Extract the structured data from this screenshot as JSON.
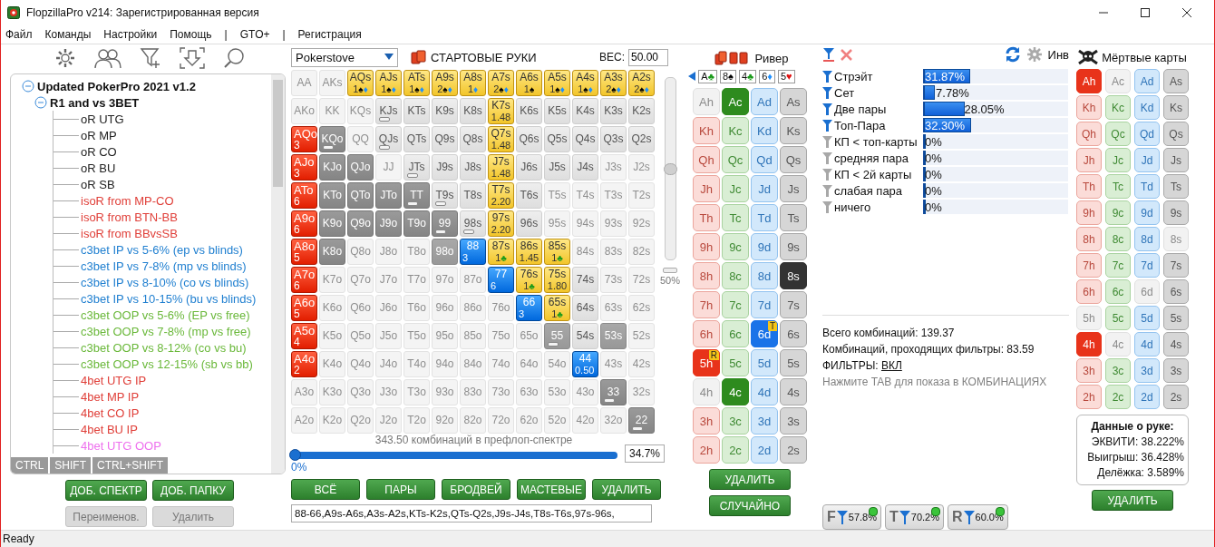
{
  "window": {
    "title": "FlopzillaPro v214: Зарегистрированная версия"
  },
  "menu": [
    "Файл",
    "Команды",
    "Настройки",
    "Помощь",
    "|",
    "GTO+",
    "|",
    "Регистрация"
  ],
  "tree": {
    "items": [
      {
        "label": "Updated PokerPro 2021 v1.2",
        "expanded": true,
        "children": [
          {
            "label": "R1 and vs 3BET",
            "expanded": true,
            "children": [
              {
                "label": "oR UTG",
                "color": "#222222"
              },
              {
                "label": "oR MP",
                "color": "#222222"
              },
              {
                "label": "oR CO",
                "color": "#222222"
              },
              {
                "label": "oR BU",
                "color": "#222222"
              },
              {
                "label": "oR SB",
                "color": "#222222"
              },
              {
                "label": "isoR from MP-CO",
                "color": "#e0403a"
              },
              {
                "label": "isoR from BTN-BB",
                "color": "#e0403a"
              },
              {
                "label": "isoR from BBvsSB",
                "color": "#e0403a"
              },
              {
                "label": "c3bet IP vs 5-6% (ep vs blinds)",
                "color": "#1f7fd0"
              },
              {
                "label": "c3bet IP vs 7-8% (mp vs blinds)",
                "color": "#1f7fd0"
              },
              {
                "label": "c3bet IP vs 8-10% (co vs blinds)",
                "color": "#1f7fd0"
              },
              {
                "label": "c3bet IP vs 10-15% (bu vs blinds)",
                "color": "#1f7fd0"
              },
              {
                "label": "c3bet OOP vs 5-6% (EP vs free)",
                "color": "#6ab83a"
              },
              {
                "label": "c3bet OOP vs 7-8% (mp vs free)",
                "color": "#6ab83a"
              },
              {
                "label": "c3bet OOP vs 8-12% (co vs bu)",
                "color": "#6ab83a"
              },
              {
                "label": "c3bet OOP vs 12-15% (sb vs bb)",
                "color": "#6ab83a"
              },
              {
                "label": "4bet UTG IP",
                "color": "#e0403a"
              },
              {
                "label": "4bet MP IP",
                "color": "#e0403a"
              },
              {
                "label": "4bet CO IP",
                "color": "#e0403a"
              },
              {
                "label": "4bet BU IP",
                "color": "#e0403a"
              },
              {
                "label": "4bet UTG OOP",
                "color": "#ee70ee"
              }
            ]
          }
        ]
      }
    ]
  },
  "modifier_tabs": [
    "CTRL",
    "SHIFT",
    "CTRL+SHIFT"
  ],
  "tree_buttons": [
    {
      "label": "ДОБ. СПЕКТР",
      "disabled": false
    },
    {
      "label": "ДОБ. ПАПКУ",
      "disabled": false
    },
    {
      "label": "Переименов.",
      "disabled": true
    },
    {
      "label": "Удалить",
      "disabled": true
    }
  ],
  "range": {
    "source": "Pokerstove",
    "title": "СТАРТОВЫЕ РУКИ",
    "weight_label": "ВЕС:",
    "weight": "50.00",
    "rows": [
      [
        {
          "label": "AA",
          "kind": "empty",
          "bar": false
        },
        {
          "label": "AKs",
          "kind": "empty",
          "bar": false
        },
        {
          "label": "AQs",
          "kind": "yellow",
          "bar": false,
          "sub": "1",
          "suits": [
            {
              "symbol": "♠",
              "color": "#000000"
            },
            {
              "symbol": "♦",
              "color": "#1e90ff"
            }
          ]
        },
        {
          "label": "AJs",
          "kind": "yellow",
          "bar": false,
          "sub": "1",
          "suits": [
            {
              "symbol": "♠",
              "color": "#000000"
            },
            {
              "symbol": "♦",
              "color": "#1e90ff"
            }
          ]
        },
        {
          "label": "ATs",
          "kind": "yellow",
          "bar": false,
          "sub": "1",
          "suits": [
            {
              "symbol": "♠",
              "color": "#000000"
            },
            {
              "symbol": "♦",
              "color": "#1e90ff"
            }
          ]
        },
        {
          "label": "A9s",
          "kind": "yellow",
          "bar": false,
          "sub": "2",
          "suits": [
            {
              "symbol": "♠",
              "color": "#000000"
            },
            {
              "symbol": "♦",
              "color": "#1e90ff"
            }
          ]
        },
        {
          "label": "A8s",
          "kind": "yellow",
          "bar": false,
          "sub": "1",
          "suits": [
            {
              "symbol": "♦",
              "color": "#1e90ff"
            }
          ]
        },
        {
          "label": "A7s",
          "kind": "yellow",
          "bar": false,
          "sub": "2",
          "suits": [
            {
              "symbol": "♠",
              "color": "#000000"
            },
            {
              "symbol": "♦",
              "color": "#1e90ff"
            }
          ]
        },
        {
          "label": "A6s",
          "kind": "yellow",
          "bar": false,
          "sub": "1",
          "suits": [
            {
              "symbol": "♠",
              "color": "#000000"
            }
          ]
        },
        {
          "label": "A5s",
          "kind": "yellow",
          "bar": false,
          "sub": "1",
          "suits": [
            {
              "symbol": "♠",
              "color": "#000000"
            },
            {
              "symbol": "♦",
              "color": "#1e90ff"
            }
          ]
        },
        {
          "label": "A4s",
          "kind": "yellow",
          "bar": false,
          "sub": "1",
          "suits": [
            {
              "symbol": "♠",
              "color": "#000000"
            },
            {
              "symbol": "♦",
              "color": "#1e90ff"
            }
          ]
        },
        {
          "label": "A3s",
          "kind": "yellow",
          "bar": false,
          "sub": "2",
          "suits": [
            {
              "symbol": "♠",
              "color": "#000000"
            },
            {
              "symbol": "♦",
              "color": "#1e90ff"
            }
          ]
        },
        {
          "label": "A2s",
          "kind": "yellow",
          "bar": false,
          "sub": "2",
          "suits": [
            {
              "symbol": "♠",
              "color": "#000000"
            },
            {
              "symbol": "♦",
              "color": "#1e90ff"
            }
          ]
        }
      ],
      [
        {
          "label": "AKo",
          "kind": "empty",
          "bar": false
        },
        {
          "label": "KK",
          "kind": "empty",
          "bar": false
        },
        {
          "label": "KQs",
          "kind": "empty",
          "bar": false
        },
        {
          "label": "KJs",
          "kind": "plain",
          "bar": true
        },
        {
          "label": "KTs",
          "kind": "plain",
          "bar": false
        },
        {
          "label": "K9s",
          "kind": "plain",
          "bar": false
        },
        {
          "label": "K8s",
          "kind": "plain",
          "bar": false
        },
        {
          "label": "K7s",
          "kind": "yellow",
          "bar": false,
          "sub": "1.48"
        },
        {
          "label": "K6s",
          "kind": "plain",
          "bar": false
        },
        {
          "label": "K5s",
          "kind": "plain",
          "bar": false
        },
        {
          "label": "K4s",
          "kind": "plain",
          "bar": false
        },
        {
          "label": "K3s",
          "kind": "plain",
          "bar": false
        },
        {
          "label": "K2s",
          "kind": "plain",
          "bar": false
        }
      ],
      [
        {
          "label": "AQo",
          "kind": "red",
          "bar": false,
          "sub": "3"
        },
        {
          "label": "KQo",
          "kind": "gray",
          "bar": true
        },
        {
          "label": "QQ",
          "kind": "empty",
          "bar": false
        },
        {
          "label": "QJs",
          "kind": "plain",
          "bar": true
        },
        {
          "label": "QTs",
          "kind": "plain",
          "bar": false
        },
        {
          "label": "Q9s",
          "kind": "plain",
          "bar": false
        },
        {
          "label": "Q8s",
          "kind": "plain",
          "bar": false
        },
        {
          "label": "Q7s",
          "kind": "yellow",
          "bar": false,
          "sub": "1.48"
        },
        {
          "label": "Q6s",
          "kind": "plain",
          "bar": false
        },
        {
          "label": "Q5s",
          "kind": "plain",
          "bar": false
        },
        {
          "label": "Q4s",
          "kind": "plain",
          "bar": false
        },
        {
          "label": "Q3s",
          "kind": "plain",
          "bar": false
        },
        {
          "label": "Q2s",
          "kind": "plain",
          "bar": false
        }
      ],
      [
        {
          "label": "AJo",
          "kind": "red",
          "bar": false,
          "sub": "3"
        },
        {
          "label": "KJo",
          "kind": "gray",
          "bar": false
        },
        {
          "label": "QJo",
          "kind": "gray",
          "bar": false
        },
        {
          "label": "JJ",
          "kind": "empty",
          "bar": false
        },
        {
          "label": "JTs",
          "kind": "plain",
          "bar": true
        },
        {
          "label": "J9s",
          "kind": "plain",
          "bar": false
        },
        {
          "label": "J8s",
          "kind": "plain",
          "bar": false
        },
        {
          "label": "J7s",
          "kind": "yellow",
          "bar": false,
          "sub": "1.48"
        },
        {
          "label": "J6s",
          "kind": "plain",
          "bar": false
        },
        {
          "label": "J5s",
          "kind": "plain",
          "bar": false
        },
        {
          "label": "J4s",
          "kind": "plain",
          "bar": false
        },
        {
          "label": "J3s",
          "kind": "empty",
          "bar": false
        },
        {
          "label": "J2s",
          "kind": "empty",
          "bar": false
        }
      ],
      [
        {
          "label": "ATo",
          "kind": "red",
          "bar": false,
          "sub": "6"
        },
        {
          "label": "KTo",
          "kind": "gray",
          "bar": false
        },
        {
          "label": "QTo",
          "kind": "gray",
          "bar": false
        },
        {
          "label": "JTo",
          "kind": "gray",
          "bar": false
        },
        {
          "label": "TT",
          "kind": "gray",
          "bar": true
        },
        {
          "label": "T9s",
          "kind": "plain",
          "bar": true
        },
        {
          "label": "T8s",
          "kind": "plain",
          "bar": false
        },
        {
          "label": "T7s",
          "kind": "yellow",
          "bar": false,
          "sub": "2.20"
        },
        {
          "label": "T6s",
          "kind": "plain",
          "bar": false
        },
        {
          "label": "T5s",
          "kind": "empty",
          "bar": false
        },
        {
          "label": "T4s",
          "kind": "empty",
          "bar": false
        },
        {
          "label": "T3s",
          "kind": "empty",
          "bar": false
        },
        {
          "label": "T2s",
          "kind": "empty",
          "bar": false
        }
      ],
      [
        {
          "label": "A9o",
          "kind": "red",
          "bar": false,
          "sub": "6"
        },
        {
          "label": "K9o",
          "kind": "gray",
          "bar": false
        },
        {
          "label": "Q9o",
          "kind": "gray",
          "bar": false
        },
        {
          "label": "J9o",
          "kind": "gray",
          "bar": false
        },
        {
          "label": "T9o",
          "kind": "gray",
          "bar": false
        },
        {
          "label": "99",
          "kind": "gray",
          "bar": true
        },
        {
          "label": "98s",
          "kind": "plain",
          "bar": true
        },
        {
          "label": "97s",
          "kind": "yellow",
          "bar": false,
          "sub": "2.20"
        },
        {
          "label": "96s",
          "kind": "plain",
          "bar": false
        },
        {
          "label": "95s",
          "kind": "empty",
          "bar": false
        },
        {
          "label": "94s",
          "kind": "empty",
          "bar": false
        },
        {
          "label": "93s",
          "kind": "empty",
          "bar": false
        },
        {
          "label": "92s",
          "kind": "empty",
          "bar": false
        }
      ],
      [
        {
          "label": "A8o",
          "kind": "red",
          "bar": false,
          "sub": "5"
        },
        {
          "label": "K8o",
          "kind": "gray",
          "bar": false
        },
        {
          "label": "Q8o",
          "kind": "empty",
          "bar": false
        },
        {
          "label": "J8o",
          "kind": "empty",
          "bar": false
        },
        {
          "label": "T8o",
          "kind": "empty",
          "bar": false
        },
        {
          "label": "98o",
          "kind": "mid",
          "bar": false
        },
        {
          "label": "88",
          "kind": "blue",
          "bar": false,
          "sub": "3"
        },
        {
          "label": "87s",
          "kind": "yellow",
          "bar": false,
          "sub": "1",
          "suits": [
            {
              "symbol": "♣",
              "color": "#1a9a1a"
            }
          ]
        },
        {
          "label": "86s",
          "kind": "yellow",
          "bar": false,
          "sub": "1.45"
        },
        {
          "label": "85s",
          "kind": "yellow",
          "bar": false,
          "sub": "1",
          "suits": [
            {
              "symbol": "♣",
              "color": "#1a9a1a"
            }
          ]
        },
        {
          "label": "84s",
          "kind": "empty",
          "bar": false
        },
        {
          "label": "83s",
          "kind": "empty",
          "bar": false
        },
        {
          "label": "82s",
          "kind": "empty",
          "bar": false
        }
      ],
      [
        {
          "label": "A7o",
          "kind": "red",
          "bar": false,
          "sub": "6"
        },
        {
          "label": "K7o",
          "kind": "empty",
          "bar": false
        },
        {
          "label": "Q7o",
          "kind": "empty",
          "bar": false
        },
        {
          "label": "J7o",
          "kind": "empty",
          "bar": false
        },
        {
          "label": "T7o",
          "kind": "empty",
          "bar": false
        },
        {
          "label": "97o",
          "kind": "empty",
          "bar": false
        },
        {
          "label": "87o",
          "kind": "empty",
          "bar": false
        },
        {
          "label": "77",
          "kind": "blue",
          "bar": false,
          "sub": "6"
        },
        {
          "label": "76s",
          "kind": "yellow",
          "bar": false,
          "sub": "1",
          "suits": [
            {
              "symbol": "♣",
              "color": "#1a9a1a"
            }
          ]
        },
        {
          "label": "75s",
          "kind": "yellow",
          "bar": false,
          "sub": "1.80"
        },
        {
          "label": "74s",
          "kind": "plain",
          "bar": false
        },
        {
          "label": "73s",
          "kind": "empty",
          "bar": false
        },
        {
          "label": "72s",
          "kind": "empty",
          "bar": false
        }
      ],
      [
        {
          "label": "A6o",
          "kind": "red",
          "bar": false,
          "sub": "5"
        },
        {
          "label": "K6o",
          "kind": "empty",
          "bar": false
        },
        {
          "label": "Q6o",
          "kind": "empty",
          "bar": false
        },
        {
          "label": "J6o",
          "kind": "empty",
          "bar": false
        },
        {
          "label": "T6o",
          "kind": "empty",
          "bar": false
        },
        {
          "label": "96o",
          "kind": "empty",
          "bar": false
        },
        {
          "label": "86o",
          "kind": "empty",
          "bar": false
        },
        {
          "label": "76o",
          "kind": "empty",
          "bar": false
        },
        {
          "label": "66",
          "kind": "blue",
          "bar": false,
          "sub": "3"
        },
        {
          "label": "65s",
          "kind": "yellow",
          "bar": false,
          "sub": "1",
          "suits": [
            {
              "symbol": "♣",
              "color": "#1a9a1a"
            }
          ]
        },
        {
          "label": "64s",
          "kind": "plain",
          "bar": false
        },
        {
          "label": "63s",
          "kind": "empty",
          "bar": false
        },
        {
          "label": "62s",
          "kind": "empty",
          "bar": false
        }
      ],
      [
        {
          "label": "A5o",
          "kind": "red",
          "bar": false,
          "sub": "4"
        },
        {
          "label": "K5o",
          "kind": "empty",
          "bar": false
        },
        {
          "label": "Q5o",
          "kind": "empty",
          "bar": false
        },
        {
          "label": "J5o",
          "kind": "empty",
          "bar": false
        },
        {
          "label": "T5o",
          "kind": "empty",
          "bar": false
        },
        {
          "label": "95o",
          "kind": "empty",
          "bar": false
        },
        {
          "label": "85o",
          "kind": "empty",
          "bar": false
        },
        {
          "label": "75o",
          "kind": "empty",
          "bar": false
        },
        {
          "label": "65o",
          "kind": "empty",
          "bar": false
        },
        {
          "label": "55",
          "kind": "mid",
          "bar": true
        },
        {
          "label": "54s",
          "kind": "plain",
          "bar": false
        },
        {
          "label": "53s",
          "kind": "mid",
          "bar": false
        },
        {
          "label": "52s",
          "kind": "empty",
          "bar": false
        }
      ],
      [
        {
          "label": "A4o",
          "kind": "red",
          "bar": false,
          "sub": "2"
        },
        {
          "label": "K4o",
          "kind": "empty",
          "bar": false
        },
        {
          "label": "Q4o",
          "kind": "empty",
          "bar": false
        },
        {
          "label": "J4o",
          "kind": "empty",
          "bar": false
        },
        {
          "label": "T4o",
          "kind": "empty",
          "bar": false
        },
        {
          "label": "94o",
          "kind": "empty",
          "bar": false
        },
        {
          "label": "84o",
          "kind": "empty",
          "bar": false
        },
        {
          "label": "74o",
          "kind": "empty",
          "bar": false
        },
        {
          "label": "64o",
          "kind": "empty",
          "bar": false
        },
        {
          "label": "54o",
          "kind": "empty",
          "bar": false
        },
        {
          "label": "44",
          "kind": "blue",
          "bar": false,
          "sub": "0.50"
        },
        {
          "label": "43s",
          "kind": "empty",
          "bar": false
        },
        {
          "label": "42s",
          "kind": "empty",
          "bar": false
        }
      ],
      [
        {
          "label": "A3o",
          "kind": "empty",
          "bar": false
        },
        {
          "label": "K3o",
          "kind": "empty",
          "bar": false
        },
        {
          "label": "Q3o",
          "kind": "empty",
          "bar": false
        },
        {
          "label": "J3o",
          "kind": "empty",
          "bar": false
        },
        {
          "label": "T3o",
          "kind": "empty",
          "bar": false
        },
        {
          "label": "93o",
          "kind": "empty",
          "bar": false
        },
        {
          "label": "83o",
          "kind": "empty",
          "bar": false
        },
        {
          "label": "73o",
          "kind": "empty",
          "bar": false
        },
        {
          "label": "63o",
          "kind": "empty",
          "bar": false
        },
        {
          "label": "53o",
          "kind": "empty",
          "bar": false
        },
        {
          "label": "43o",
          "kind": "empty",
          "bar": false
        },
        {
          "label": "33",
          "kind": "gray",
          "bar": true
        },
        {
          "label": "32s",
          "kind": "empty",
          "bar": false
        }
      ],
      [
        {
          "label": "A2o",
          "kind": "empty",
          "bar": false
        },
        {
          "label": "K2o",
          "kind": "empty",
          "bar": false
        },
        {
          "label": "Q2o",
          "kind": "empty",
          "bar": false
        },
        {
          "label": "J2o",
          "kind": "empty",
          "bar": false
        },
        {
          "label": "T2o",
          "kind": "empty",
          "bar": false
        },
        {
          "label": "92o",
          "kind": "empty",
          "bar": false
        },
        {
          "label": "82o",
          "kind": "empty",
          "bar": false
        },
        {
          "label": "72o",
          "kind": "empty",
          "bar": false
        },
        {
          "label": "62o",
          "kind": "empty",
          "bar": false
        },
        {
          "label": "52o",
          "kind": "empty",
          "bar": false
        },
        {
          "label": "42o",
          "kind": "empty",
          "bar": false
        },
        {
          "label": "32o",
          "kind": "empty",
          "bar": false
        },
        {
          "label": "22",
          "kind": "gray",
          "bar": true
        }
      ]
    ],
    "weight_slider": {
      "level": 0.5,
      "reading": "50%"
    },
    "combos": "343.50 комбинаций в префлоп-спектре",
    "slider": {
      "level": 1,
      "start": "0%",
      "value": "34.7%"
    },
    "buttons": [
      "ВСЁ",
      "ПАРЫ",
      "БРОДВЕЙ",
      "МАСТЕВЫЕ",
      "УДАЛИТЬ"
    ],
    "text": "88-66,A9s-A6s,A3s-A2s,KTs-K2s,QTs-Q2s,J9s-J4s,T8s-T6s,97s-96s,"
  },
  "river": {
    "title": "Ривер",
    "board": [
      {
        "rank": "A",
        "suit": "♣",
        "color": "#1a9a1a"
      },
      {
        "rank": "8",
        "suit": "♠",
        "color": "#000000"
      },
      {
        "rank": "4",
        "suit": "♣",
        "color": "#1a9a1a"
      },
      {
        "rank": "6",
        "suit": "♦",
        "color": "#1e90ff"
      },
      {
        "rank": "5",
        "suit": "♥",
        "color": "#e01010"
      }
    ],
    "cards": [
      [
        {
          "label": "Ah",
          "selected": false,
          "used": true
        },
        {
          "label": "Ac",
          "selected": true,
          "used": false
        },
        {
          "label": "Ad",
          "selected": false,
          "used": false
        },
        {
          "label": "As",
          "selected": false,
          "used": false
        }
      ],
      [
        {
          "label": "Kh",
          "selected": false,
          "used": false
        },
        {
          "label": "Kc",
          "selected": false,
          "used": false
        },
        {
          "label": "Kd",
          "selected": false,
          "used": false
        },
        {
          "label": "Ks",
          "selected": false,
          "used": false
        }
      ],
      [
        {
          "label": "Qh",
          "selected": false,
          "used": false
        },
        {
          "label": "Qc",
          "selected": false,
          "used": false
        },
        {
          "label": "Qd",
          "selected": false,
          "used": false
        },
        {
          "label": "Qs",
          "selected": false,
          "used": false
        }
      ],
      [
        {
          "label": "Jh",
          "selected": false,
          "used": false
        },
        {
          "label": "Jc",
          "selected": false,
          "used": false
        },
        {
          "label": "Jd",
          "selected": false,
          "used": false
        },
        {
          "label": "Js",
          "selected": false,
          "used": false
        }
      ],
      [
        {
          "label": "Th",
          "selected": false,
          "used": false
        },
        {
          "label": "Tc",
          "selected": false,
          "used": false
        },
        {
          "label": "Td",
          "selected": false,
          "used": false
        },
        {
          "label": "Ts",
          "selected": false,
          "used": false
        }
      ],
      [
        {
          "label": "9h",
          "selected": false,
          "used": false
        },
        {
          "label": "9c",
          "selected": false,
          "used": false
        },
        {
          "label": "9d",
          "selected": false,
          "used": false
        },
        {
          "label": "9s",
          "selected": false,
          "used": false
        }
      ],
      [
        {
          "label": "8h",
          "selected": false,
          "used": false
        },
        {
          "label": "8c",
          "selected": false,
          "used": false
        },
        {
          "label": "8d",
          "selected": false,
          "used": false
        },
        {
          "label": "8s",
          "selected": true,
          "used": false
        }
      ],
      [
        {
          "label": "7h",
          "selected": false,
          "used": false
        },
        {
          "label": "7c",
          "selected": false,
          "used": false
        },
        {
          "label": "7d",
          "selected": false,
          "used": false
        },
        {
          "label": "7s",
          "selected": false,
          "used": false
        }
      ],
      [
        {
          "label": "6h",
          "selected": false,
          "used": false
        },
        {
          "label": "6c",
          "selected": false,
          "used": false
        },
        {
          "label": "6d",
          "selected": true,
          "used": false,
          "badge": "T"
        },
        {
          "label": "6s",
          "selected": false,
          "used": false
        }
      ],
      [
        {
          "label": "5h",
          "selected": true,
          "used": false,
          "badge": "R"
        },
        {
          "label": "5c",
          "selected": false,
          "used": false
        },
        {
          "label": "5d",
          "selected": false,
          "used": false
        },
        {
          "label": "5s",
          "selected": false,
          "used": false
        }
      ],
      [
        {
          "label": "4h",
          "selected": false,
          "used": true
        },
        {
          "label": "4c",
          "selected": true,
          "used": false
        },
        {
          "label": "4d",
          "selected": false,
          "used": false
        },
        {
          "label": "4s",
          "selected": false,
          "used": false
        }
      ],
      [
        {
          "label": "3h",
          "selected": false,
          "used": false
        },
        {
          "label": "3c",
          "selected": false,
          "used": false
        },
        {
          "label": "3d",
          "selected": false,
          "used": false
        },
        {
          "label": "3s",
          "selected": false,
          "used": false
        }
      ],
      [
        {
          "label": "2h",
          "selected": false,
          "used": false
        },
        {
          "label": "2c",
          "selected": false,
          "used": false
        },
        {
          "label": "2d",
          "selected": false,
          "used": false
        },
        {
          "label": "2s",
          "selected": false,
          "used": false
        }
      ]
    ],
    "buttons": [
      "УДАЛИТЬ",
      "СЛУЧАЙНО"
    ]
  },
  "filters": {
    "inv": "Инв",
    "items": [
      {
        "label": "Стрэйт",
        "active": true,
        "level": 0.3187,
        "value": "31.87%"
      },
      {
        "label": "Сет",
        "active": true,
        "level": 0.0778,
        "value": "7.78%"
      },
      {
        "label": "Две пары",
        "active": true,
        "level": 0.2805,
        "value": "28.05%"
      },
      {
        "label": "Топ-Пара",
        "active": true,
        "level": 0.323,
        "value": "32.30%"
      },
      {
        "label": "КП < топ-карты",
        "active": false,
        "level": 0,
        "value": "0%"
      },
      {
        "label": "средняя пара",
        "active": false,
        "level": 0,
        "value": "0%"
      },
      {
        "label": "КП < 2й карты",
        "active": false,
        "level": 0,
        "value": "0%"
      },
      {
        "label": "слабая пара",
        "active": false,
        "level": 0,
        "value": "0%"
      },
      {
        "label": "ничего",
        "active": false,
        "level": 0,
        "value": "0%"
      }
    ],
    "total": "Всего комбинаций: 139.37",
    "passing": "Комбинаций, проходящих фильтры: 83.59",
    "filters_label": "ФИЛЬТРЫ:",
    "filters_state": "ВКЛ",
    "hint": "Нажмите TAB для показа в КОМБИНАЦИЯХ",
    "chips": [
      {
        "letter": "F",
        "value": "57.8%"
      },
      {
        "letter": "T",
        "value": "70.2%"
      },
      {
        "letter": "R",
        "value": "60.0%"
      }
    ]
  },
  "dead_cards": {
    "title": "Мёртвые карты",
    "cards": [
      [
        {
          "label": "Ah",
          "selected": true,
          "used": false
        },
        {
          "label": "Ac",
          "selected": false,
          "used": true
        },
        {
          "label": "Ad",
          "selected": false,
          "used": false
        },
        {
          "label": "As",
          "selected": false,
          "used": false
        }
      ],
      [
        {
          "label": "Kh",
          "selected": false,
          "used": false
        },
        {
          "label": "Kc",
          "selected": false,
          "used": false
        },
        {
          "label": "Kd",
          "selected": false,
          "used": false
        },
        {
          "label": "Ks",
          "selected": false,
          "used": false
        }
      ],
      [
        {
          "label": "Qh",
          "selected": false,
          "used": false
        },
        {
          "label": "Qc",
          "selected": false,
          "used": false
        },
        {
          "label": "Qd",
          "selected": false,
          "used": false
        },
        {
          "label": "Qs",
          "selected": false,
          "used": false
        }
      ],
      [
        {
          "label": "Jh",
          "selected": false,
          "used": false
        },
        {
          "label": "Jc",
          "selected": false,
          "used": false
        },
        {
          "label": "Jd",
          "selected": false,
          "used": false
        },
        {
          "label": "Js",
          "selected": false,
          "used": false
        }
      ],
      [
        {
          "label": "Th",
          "selected": false,
          "used": false
        },
        {
          "label": "Tc",
          "selected": false,
          "used": false
        },
        {
          "label": "Td",
          "selected": false,
          "used": false
        },
        {
          "label": "Ts",
          "selected": false,
          "used": false
        }
      ],
      [
        {
          "label": "9h",
          "selected": false,
          "used": false
        },
        {
          "label": "9c",
          "selected": false,
          "used": false
        },
        {
          "label": "9d",
          "selected": false,
          "used": false
        },
        {
          "label": "9s",
          "selected": false,
          "used": false
        }
      ],
      [
        {
          "label": "8h",
          "selected": false,
          "used": false
        },
        {
          "label": "8c",
          "selected": false,
          "used": false
        },
        {
          "label": "8d",
          "selected": false,
          "used": false
        },
        {
          "label": "8s",
          "selected": false,
          "used": true
        }
      ],
      [
        {
          "label": "7h",
          "selected": false,
          "used": false
        },
        {
          "label": "7c",
          "selected": false,
          "used": false
        },
        {
          "label": "7d",
          "selected": false,
          "used": false
        },
        {
          "label": "7s",
          "selected": false,
          "used": false
        }
      ],
      [
        {
          "label": "6h",
          "selected": false,
          "used": false
        },
        {
          "label": "6c",
          "selected": false,
          "used": false
        },
        {
          "label": "6d",
          "selected": false,
          "used": true
        },
        {
          "label": "6s",
          "selected": false,
          "used": false
        }
      ],
      [
        {
          "label": "5h",
          "selected": false,
          "used": true
        },
        {
          "label": "5c",
          "selected": false,
          "used": false
        },
        {
          "label": "5d",
          "selected": false,
          "used": false
        },
        {
          "label": "5s",
          "selected": false,
          "used": false
        }
      ],
      [
        {
          "label": "4h",
          "selected": true,
          "used": false
        },
        {
          "label": "4c",
          "selected": false,
          "used": true
        },
        {
          "label": "4d",
          "selected": false,
          "used": false
        },
        {
          "label": "4s",
          "selected": false,
          "used": false
        }
      ],
      [
        {
          "label": "3h",
          "selected": false,
          "used": false
        },
        {
          "label": "3c",
          "selected": false,
          "used": false
        },
        {
          "label": "3d",
          "selected": false,
          "used": false
        },
        {
          "label": "3s",
          "selected": false,
          "used": false
        }
      ],
      [
        {
          "label": "2h",
          "selected": false,
          "used": false
        },
        {
          "label": "2c",
          "selected": false,
          "used": false
        },
        {
          "label": "2d",
          "selected": false,
          "used": false
        },
        {
          "label": "2s",
          "selected": false,
          "used": false
        }
      ]
    ],
    "hand_data": {
      "title": "Данные о руке:",
      "lines": [
        "ЭКВИТИ: 38.222%",
        "Выигрыш: 36.428%",
        "Делёжка: 3.589%"
      ]
    },
    "button": "УДАЛИТЬ"
  },
  "status_bar": "Ready"
}
